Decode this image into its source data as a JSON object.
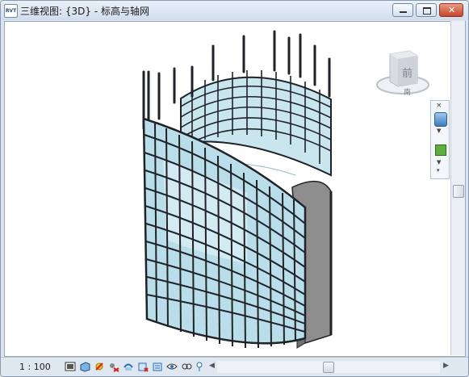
{
  "window": {
    "title": "三维视图: {3D} - 标高与轴网",
    "icon_label": "RVT",
    "buttons": [
      "minimize",
      "maximize",
      "close"
    ]
  },
  "viewcube": {
    "face_label": "前",
    "compass_label": "南"
  },
  "navigation_bar": {
    "close_glyph": "×",
    "tools": [
      "steering-wheel",
      "zoom-region"
    ]
  },
  "status_bar": {
    "scale": "1 : 100",
    "tools": [
      "detail-level",
      "visual-style",
      "sun-path",
      "shadows",
      "crop-view",
      "show-crop",
      "unlock-3d",
      "temporary-hide",
      "reveal-hidden",
      "analytical-model"
    ]
  },
  "colors": {
    "glass": "#b9dde9",
    "mullion": "#1f2328",
    "wall": "#8d8d8d",
    "viewport_bg": "#ffffff"
  }
}
